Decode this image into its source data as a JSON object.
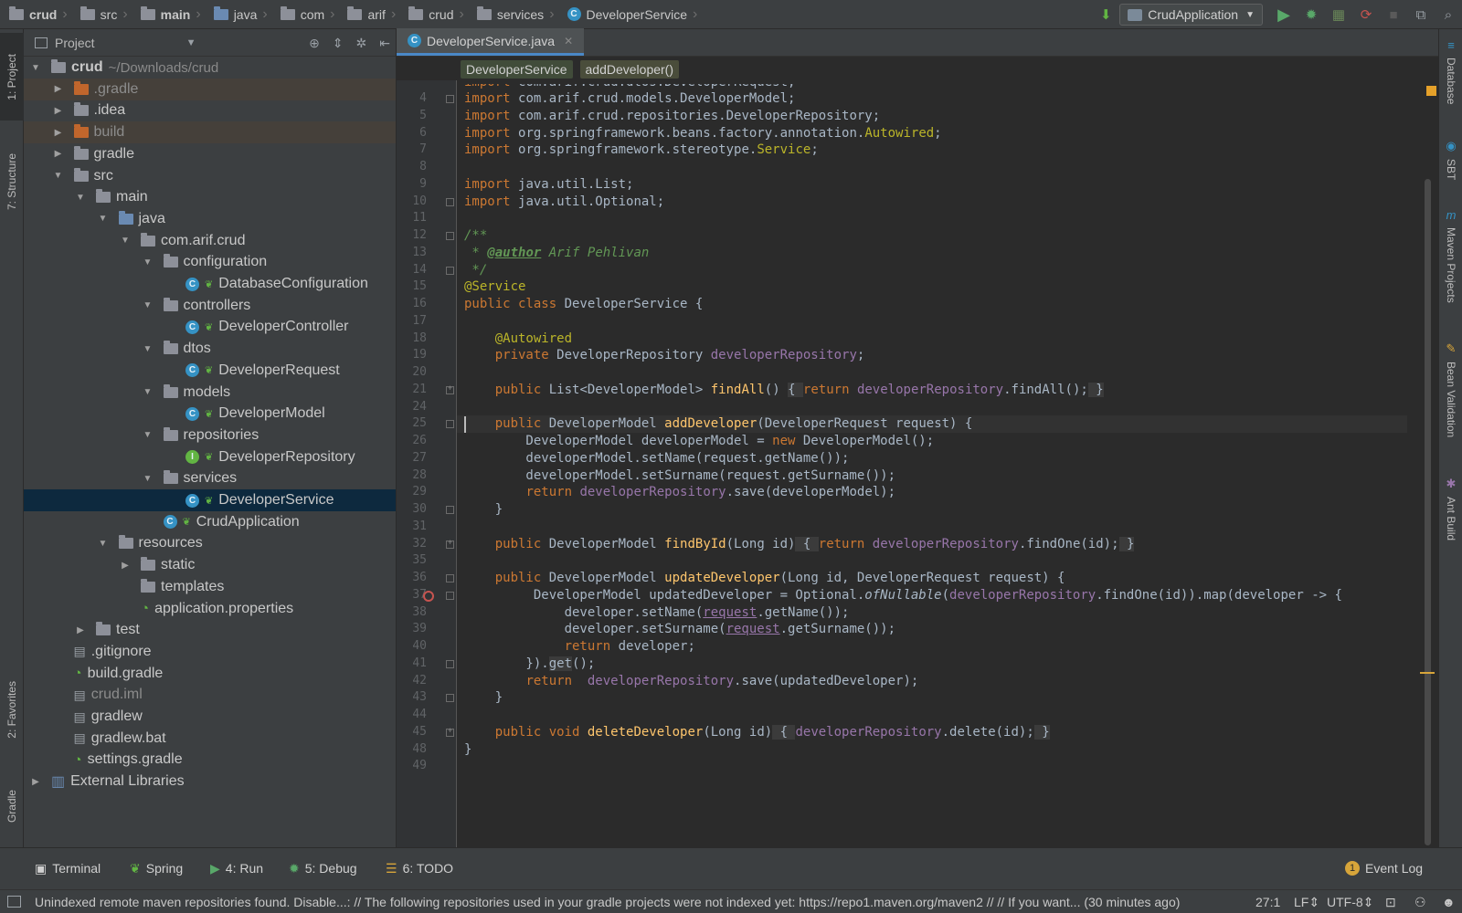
{
  "breadcrumbs": [
    "crud",
    "src",
    "main",
    "java",
    "com",
    "arif",
    "crud",
    "services",
    "DeveloperService"
  ],
  "run_config": "CrudApplication",
  "project_panel": {
    "title": "Project",
    "tree": [
      {
        "label": "crud",
        "extra": "~/Downloads/crud",
        "kind": "root"
      },
      {
        "label": ".gradle",
        "kind": "folder-orange"
      },
      {
        "label": ".idea",
        "kind": "folder"
      },
      {
        "label": "build",
        "kind": "folder-orange"
      },
      {
        "label": "gradle",
        "kind": "folder"
      },
      {
        "label": "src",
        "kind": "folder"
      },
      {
        "label": "main",
        "kind": "folder"
      },
      {
        "label": "java",
        "kind": "folder-src"
      },
      {
        "label": "com.arif.crud",
        "kind": "package"
      },
      {
        "label": "configuration",
        "kind": "package"
      },
      {
        "label": "DatabaseConfiguration",
        "kind": "class"
      },
      {
        "label": "controllers",
        "kind": "package"
      },
      {
        "label": "DeveloperController",
        "kind": "class"
      },
      {
        "label": "dtos",
        "kind": "package"
      },
      {
        "label": "DeveloperRequest",
        "kind": "class"
      },
      {
        "label": "models",
        "kind": "package"
      },
      {
        "label": "DeveloperModel",
        "kind": "class"
      },
      {
        "label": "repositories",
        "kind": "package"
      },
      {
        "label": "DeveloperRepository",
        "kind": "interface"
      },
      {
        "label": "services",
        "kind": "package"
      },
      {
        "label": "DeveloperService",
        "kind": "class"
      },
      {
        "label": "CrudApplication",
        "kind": "app"
      },
      {
        "label": "resources",
        "kind": "folder"
      },
      {
        "label": "static",
        "kind": "folder"
      },
      {
        "label": "templates",
        "kind": "folder"
      },
      {
        "label": "application.properties",
        "kind": "props"
      },
      {
        "label": "test",
        "kind": "folder"
      },
      {
        "label": ".gitignore",
        "kind": "file"
      },
      {
        "label": "build.gradle",
        "kind": "gradle"
      },
      {
        "label": "crud.iml",
        "kind": "file-dim"
      },
      {
        "label": "gradlew",
        "kind": "file"
      },
      {
        "label": "gradlew.bat",
        "kind": "file"
      },
      {
        "label": "settings.gradle",
        "kind": "gradle"
      },
      {
        "label": "External Libraries",
        "kind": "libs"
      }
    ]
  },
  "editor": {
    "tab": "DeveloperService.java",
    "code_breadcrumbs": [
      "DeveloperService",
      "addDeveloper()"
    ],
    "line_numbers": [
      "4",
      "5",
      "6",
      "7",
      "8",
      "9",
      "10",
      "11",
      "12",
      "13",
      "14",
      "15",
      "16",
      "17",
      "18",
      "19",
      "20",
      "21",
      "24",
      "25",
      "26",
      "27",
      "28",
      "29",
      "30",
      "31",
      "32",
      "35",
      "36",
      "37",
      "38",
      "39",
      "40",
      "41",
      "42",
      "43",
      "44",
      "45",
      "48",
      "49"
    ]
  },
  "left_tools": [
    "1: Project",
    "7: Structure",
    "2: Favorites",
    "Gradle"
  ],
  "right_tools": [
    "Database",
    "SBT",
    "Maven Projects",
    "Bean Validation",
    "Ant Build"
  ],
  "bottom_tools": [
    {
      "label": "Terminal"
    },
    {
      "label": "Spring"
    },
    {
      "label": "4: Run"
    },
    {
      "label": "5: Debug"
    },
    {
      "label": "6: TODO"
    }
  ],
  "event_log": {
    "label": "Event Log",
    "count": "1"
  },
  "status": {
    "message": "Unindexed remote maven repositories found. Disable...: // The following repositories used in your gradle projects were not indexed yet: https://repo1.maven.org/maven2 // // If you want... (30 minutes ago)",
    "position": "27:1",
    "line_sep": "LF⇕",
    "encoding": "UTF-8⇕"
  }
}
